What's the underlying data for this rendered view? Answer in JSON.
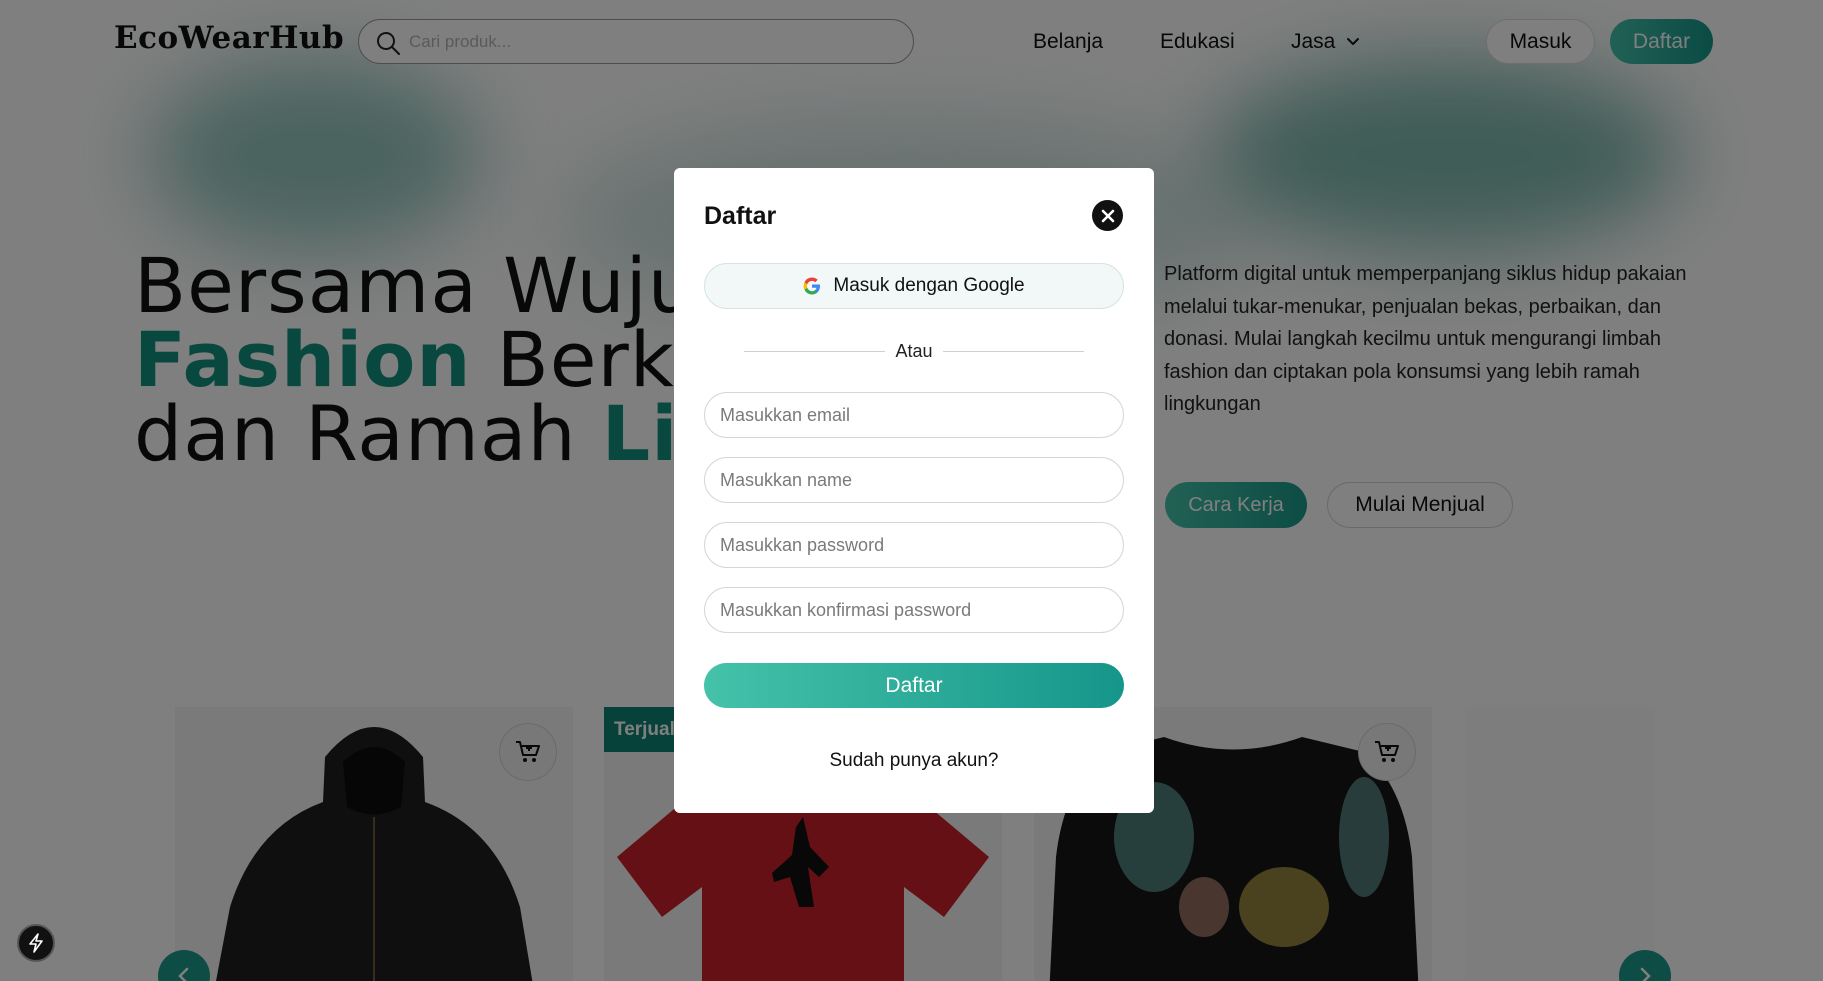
{
  "header": {
    "logo": "EcoWearHub",
    "search_placeholder": "Cari produk...",
    "nav": {
      "shop": "Belanja",
      "education": "Edukasi",
      "services": "Jasa"
    },
    "login": "Masuk",
    "register": "Daftar"
  },
  "hero": {
    "line1_text": "Bersama Wuju",
    "line2_accent": "Fashion",
    "line2_text": " Berke",
    "line3_text": "dan Ramah ",
    "line3_accent": "Li",
    "description": "Platform digital untuk memperpanjang siklus hidup pakaian melalui tukar-menukar, penjualan bekas, perbaikan, dan donasi. Mulai langkah kecilmu untuk mengurangi limbah fashion dan ciptakan pola konsumsi yang lebih ramah lingkungan",
    "how_it_works": "Cara Kerja",
    "start_selling": "Mulai Menjual"
  },
  "products": {
    "sold_tag": "Terjual"
  },
  "modal": {
    "title": "Daftar",
    "google_button": "Masuk dengan Google",
    "divider": "Atau",
    "email_placeholder": "Masukkan email",
    "name_placeholder": "Masukkan name",
    "password_placeholder": "Masukkan password",
    "confirm_password_placeholder": "Masukkan konfirmasi password",
    "submit": "Daftar",
    "login_link": "Sudah punya akun?"
  },
  "colors": {
    "accent": "#13907f",
    "gradient_start": "#45c2a9",
    "gradient_end": "#15968a",
    "sold_tag": "#0f8574"
  },
  "icons": [
    "search-icon",
    "chevron-down-icon",
    "cart-icon",
    "google-icon",
    "close-icon",
    "arrow-left-icon",
    "arrow-right-icon",
    "bolt-icon"
  ]
}
